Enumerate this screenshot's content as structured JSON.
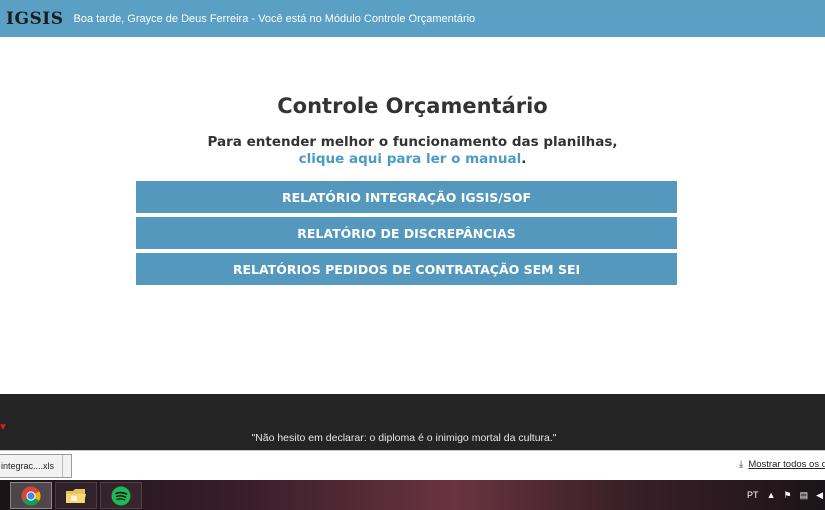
{
  "header": {
    "logo": "IGSIS",
    "greeting": "Boa tarde, Grayce de Deus Ferreira - Você está no Módulo Controle Orçamentário"
  },
  "main": {
    "title": "Controle Orçamentário",
    "intro_text": "Para entender melhor o funcionamento das planilhas,",
    "manual_link": "clique aqui para ler o manual",
    "intro_end": ".",
    "buttons": [
      "RELATÓRIO INTEGRAÇÃO IGSIS/SOF",
      "RELATÓRIO DE DISCREPÂNCIAS",
      "RELATÓRIOS PEDIDOS DE CONTRATAÇÃO SEM SEI"
    ]
  },
  "footer": {
    "quote": "\"Não hesito em declarar: o diploma é o inimigo mortal da cultura.\""
  },
  "download_bar": {
    "file_name": "integrac....xls",
    "show_all": "Mostrar todos os d"
  },
  "taskbar": {
    "apps": [
      "chrome-icon",
      "explorer-icon",
      "spotify-icon"
    ],
    "language": "PT"
  },
  "colors": {
    "header_bg": "#5a9fc4",
    "button_bg": "#5598be",
    "link": "#4a9cc7",
    "footer_bg": "#242424"
  }
}
